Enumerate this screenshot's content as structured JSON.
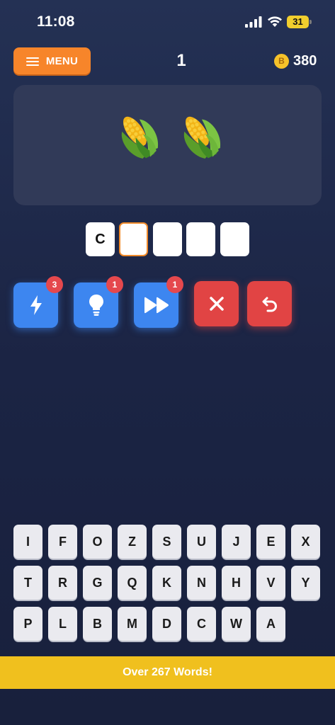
{
  "status_bar": {
    "time": "11:08",
    "battery": "31",
    "battery_color": "#f1ce2e"
  },
  "header": {
    "menu_label": "MENU",
    "level": "1",
    "coin_symbol": "B",
    "coins": "380",
    "accent": "#f7852a"
  },
  "clue": {
    "emojis": [
      "corn-emoji",
      "corn-emoji"
    ]
  },
  "answer": {
    "letters": [
      "C",
      "",
      "",
      "",
      ""
    ],
    "active_index": 1
  },
  "powerups": [
    {
      "name": "lightning",
      "count": "3",
      "color": "#3d86f0"
    },
    {
      "name": "hint-bulb",
      "count": "1",
      "color": "#3d86f0"
    },
    {
      "name": "skip",
      "count": "1",
      "color": "#3d86f0"
    },
    {
      "name": "clear",
      "color": "#e14444"
    },
    {
      "name": "undo",
      "color": "#e14444"
    }
  ],
  "keyboard": {
    "rows": [
      [
        "I",
        "F",
        "O",
        "Z",
        "S",
        "U",
        "J",
        "E",
        "X"
      ],
      [
        "T",
        "R",
        "G",
        "Q",
        "K",
        "N",
        "H",
        "V",
        "Y"
      ],
      [
        "P",
        "L",
        "B",
        "M",
        "D",
        "C",
        "W",
        "A"
      ]
    ]
  },
  "banner": {
    "text": "Over 267 Words!",
    "color": "#f0c01e"
  }
}
